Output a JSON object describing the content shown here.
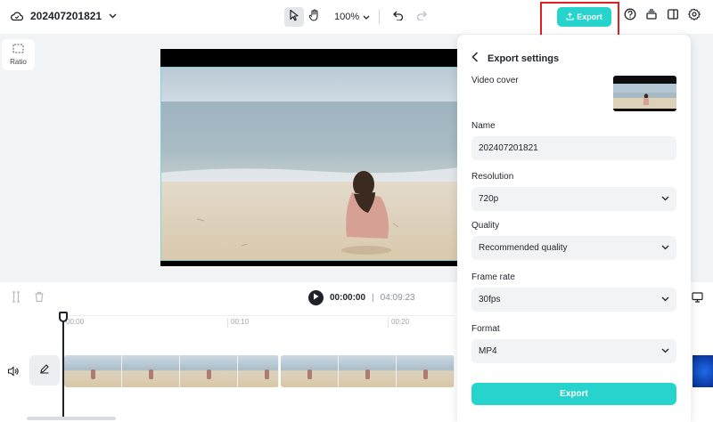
{
  "header": {
    "project_name": "202407201821",
    "zoom_label": "100%",
    "export_label": "Export"
  },
  "ratio": {
    "label": "Ratio"
  },
  "timeline": {
    "current_time": "00:00:00",
    "separator": "|",
    "total_time": "04:09:23",
    "ticks": [
      "00:00",
      "00:10",
      "00:20"
    ]
  },
  "export_panel": {
    "title": "Export settings",
    "video_cover_label": "Video cover",
    "name_label": "Name",
    "name_value": "202407201821",
    "resolution_label": "Resolution",
    "resolution_value": "720p",
    "quality_label": "Quality",
    "quality_value": "Recommended quality",
    "frame_rate_label": "Frame rate",
    "frame_rate_value": "30fps",
    "format_label": "Format",
    "format_value": "MP4",
    "export_button": "Export"
  },
  "colors": {
    "accent": "#27d3cd",
    "highlight_box": "#e02020"
  },
  "icons": [
    "cloud-icon",
    "chevron-down-icon",
    "pointer-icon",
    "hand-icon",
    "undo-icon",
    "redo-icon",
    "upload-icon",
    "help-icon",
    "stack-icon",
    "panel-icon",
    "gear-icon",
    "ratio-icon",
    "split-icon",
    "trash-icon",
    "play-icon",
    "speaker-icon",
    "pencil-icon",
    "back-arrow-icon",
    "caption-icon"
  ]
}
